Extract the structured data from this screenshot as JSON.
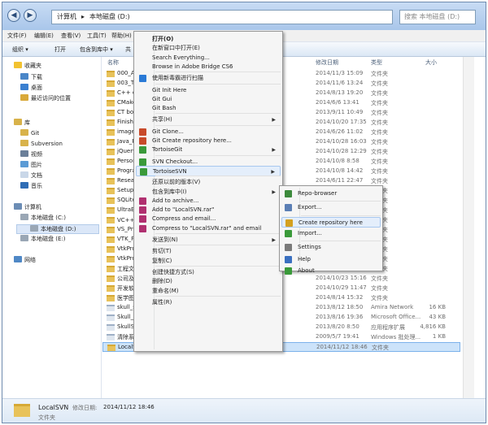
{
  "window": {
    "back_glyph": "◀",
    "forward_glyph": "▶"
  },
  "address": {
    "crumb1": "计算机",
    "sep": "▸",
    "crumb2": "本地磁盘 (D:)",
    "search_placeholder": "搜索 本地磁盘 (D:)"
  },
  "menubar": [
    "文件(F)",
    "编辑(E)",
    "查看(V)",
    "工具(T)",
    "帮助(H)"
  ],
  "toolbar": {
    "organize": "组织 ▾",
    "open": "打开",
    "include": "包含到库中 ▾",
    "share": "共"
  },
  "sidebar": {
    "favorites": "收藏夹",
    "downloads": "下载",
    "desktop": "桌面",
    "recent": "最近访问的位置",
    "libraries": "库",
    "git": "Git",
    "subversion": "Subversion",
    "video": "视频",
    "pictures": "图片",
    "documents": "文档",
    "music": "音乐",
    "computer": "计算机",
    "drive_c": "本地磁盘 (C:)",
    "drive_d": "本地磁盘 (D:)",
    "drive_e": "本地磁盘 (E:)",
    "network": "网络"
  },
  "columns": {
    "name": "名称",
    "date": "修改日期",
    "type": "类型",
    "size": "大小"
  },
  "files": [
    {
      "name": "000_AS",
      "date": "2014/11/3 15:09",
      "type": "文件夹",
      "size": ""
    },
    {
      "name": "003_TH",
      "date": "2014/11/6 13:24",
      "type": "文件夹",
      "size": ""
    },
    {
      "name": "C++ cp",
      "date": "2014/8/13 19:20",
      "type": "文件夹",
      "size": ""
    },
    {
      "name": "CMake_",
      "date": "2014/6/6 13:41",
      "type": "文件夹",
      "size": ""
    },
    {
      "name": "CT bon",
      "date": "2013/9/11 10:49",
      "type": "文件夹",
      "size": ""
    },
    {
      "name": "Finishe",
      "date": "2014/10/20 17:35",
      "type": "文件夹",
      "size": ""
    },
    {
      "name": "imageD",
      "date": "2014/6/26 11:02",
      "type": "文件夹",
      "size": ""
    },
    {
      "name": "Java_Pr",
      "date": "2014/10/28 16:03",
      "type": "文件夹",
      "size": ""
    },
    {
      "name": "jQueryE",
      "date": "2014/10/28 12:29",
      "type": "文件夹",
      "size": ""
    },
    {
      "name": "Persona",
      "date": "2014/10/8 8:58",
      "type": "文件夹",
      "size": ""
    },
    {
      "name": "Prograr",
      "date": "2014/10/8 14:42",
      "type": "文件夹",
      "size": ""
    },
    {
      "name": "Researc",
      "date": "2014/6/11 22:47",
      "type": "文件夹",
      "size": ""
    },
    {
      "name": "Setup F",
      "date": "2013/8/1 20:02",
      "type": "文件夹",
      "size": ""
    },
    {
      "name": "SQLiteS",
      "date": "2014/10/28 15:47",
      "type": "文件夹",
      "size": ""
    },
    {
      "name": "UltraEd",
      "date": "2013/9/29 16:48",
      "type": "文件夹",
      "size": ""
    },
    {
      "name": "VC++彩",
      "date": "2014/7/15 22:07",
      "type": "文件夹",
      "size": ""
    },
    {
      "name": "VS_Pro",
      "date": "2014/11/12 10:13",
      "type": "文件夹",
      "size": ""
    },
    {
      "name": "VTK_Pr",
      "date": "2014/8/4 14:30",
      "type": "文件夹",
      "size": ""
    },
    {
      "name": "VtkProj",
      "date": "2014/8/22 15:31",
      "type": "文件夹",
      "size": ""
    },
    {
      "name": "VtkProj",
      "date": "2014/8/6 14:03",
      "type": "文件夹",
      "size": ""
    },
    {
      "name": "工程文件",
      "date": "2014/11/11 15:37",
      "type": "文件夹",
      "size": ""
    },
    {
      "name": "公司及工",
      "date": "2014/10/23 15:16",
      "type": "文件夹",
      "size": ""
    },
    {
      "name": "开发软件",
      "date": "2014/10/29 11:47",
      "type": "文件夹",
      "size": ""
    },
    {
      "name": "医学图像",
      "date": "2014/8/14 15:32",
      "type": "文件夹",
      "size": ""
    },
    {
      "name": "skull_st",
      "date": "2013/8/12 18:50",
      "type": "Amira Network",
      "size": "16 KB"
    },
    {
      "name": "Skull_st",
      "date": "2013/8/16 19:36",
      "type": "Microsoft Office...",
      "size": "43 KB"
    },
    {
      "name": "SkullStr",
      "date": "2013/8/20 8:50",
      "type": "应用程序扩展",
      "size": "4,816 KB"
    },
    {
      "name": "清除系统",
      "date": "2009/5/7 19:41",
      "type": "Windows 批处理...",
      "size": "1 KB"
    },
    {
      "name": "LocalSVN",
      "date": "2014/11/12 18:46",
      "type": "文件夹",
      "size": ""
    }
  ],
  "context_menu": [
    {
      "label": "打开(O)",
      "bold": true
    },
    {
      "label": "在新窗口中打开(E)"
    },
    {
      "label": "Search Everything..."
    },
    {
      "label": "Browse in Adobe Bridge CS6"
    },
    {
      "sep": true
    },
    {
      "label": "使用新毒霸进行扫描",
      "icon": "shield-icon"
    },
    {
      "sep": true
    },
    {
      "label": "Git Init Here"
    },
    {
      "label": "Git Gui"
    },
    {
      "label": "Git Bash"
    },
    {
      "sep": true
    },
    {
      "label": "共享(H)",
      "sub": true
    },
    {
      "sep": true
    },
    {
      "label": "Git Clone...",
      "icon": "git-icon"
    },
    {
      "label": "Git Create repository here...",
      "icon": "git-icon"
    },
    {
      "label": "TortoiseGit",
      "icon": "tortoise-icon",
      "sub": true
    },
    {
      "sep": true
    },
    {
      "label": "SVN Checkout...",
      "icon": "svn-icon"
    },
    {
      "label": "TortoiseSVN",
      "icon": "tortoise-icon",
      "sub": true,
      "hl": true
    },
    {
      "sep": true
    },
    {
      "label": "还原以前的版本(V)"
    },
    {
      "label": "包含到库中(I)",
      "sub": true
    },
    {
      "label": "Add to archive...",
      "icon": "archive-icon"
    },
    {
      "label": "Add to \"LocalSVN.rar\"",
      "icon": "archive-icon"
    },
    {
      "label": "Compress and email...",
      "icon": "archive-icon"
    },
    {
      "label": "Compress to \"LocalSVN.rar\" and email",
      "icon": "archive-icon"
    },
    {
      "sep": true
    },
    {
      "label": "发送到(N)",
      "sub": true
    },
    {
      "sep": true
    },
    {
      "label": "剪切(T)"
    },
    {
      "label": "复制(C)"
    },
    {
      "sep": true
    },
    {
      "label": "创建快捷方式(S)"
    },
    {
      "label": "删除(D)"
    },
    {
      "label": "重命名(M)"
    },
    {
      "sep": true
    },
    {
      "label": "属性(R)"
    }
  ],
  "submenu": [
    {
      "label": "Repo-browser",
      "icon": "repo-icon"
    },
    {
      "sep": true
    },
    {
      "label": "Export...",
      "icon": "export-icon"
    },
    {
      "sep": true
    },
    {
      "label": "Create repository here",
      "icon": "create-repo-icon",
      "hl": true
    },
    {
      "label": "Import...",
      "icon": "import-icon"
    },
    {
      "sep": true
    },
    {
      "label": "Settings",
      "icon": "settings-icon"
    },
    {
      "label": "Help",
      "icon": "help-icon"
    },
    {
      "label": "About",
      "icon": "about-icon"
    }
  ],
  "status": {
    "name": "LocalSVN",
    "date_label": "修改日期:",
    "date": "2014/11/12 18:46",
    "type": "文件夹"
  },
  "colors": {
    "highlight": "#e4eefb",
    "selection": "#cce3fa",
    "folder": "#e8c25a"
  }
}
